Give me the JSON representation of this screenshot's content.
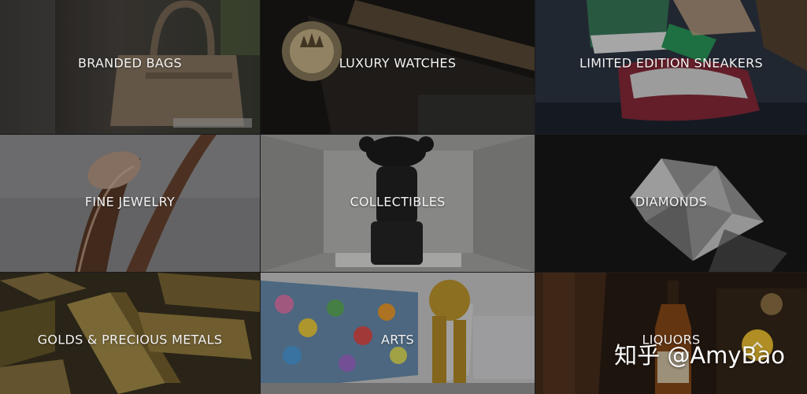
{
  "tiles": [
    {
      "label": "BRANDED BAGS"
    },
    {
      "label": "LUXURY WATCHES"
    },
    {
      "label": "LIMITED EDITION SNEAKERS"
    },
    {
      "label": "FINE JEWELRY"
    },
    {
      "label": "COLLECTIBLES"
    },
    {
      "label": "DIAMONDS"
    },
    {
      "label": "GOLDS & PRECIOUS METALS"
    },
    {
      "label": "ARTS"
    },
    {
      "label": "LIQUORS"
    }
  ],
  "watermark": "知乎 @AmyBao",
  "colors": {
    "label_text": "#f4f4f4",
    "scroll_top_bg": "#c9a227"
  },
  "icons": {
    "scroll_top": "chevron-up-icon"
  }
}
